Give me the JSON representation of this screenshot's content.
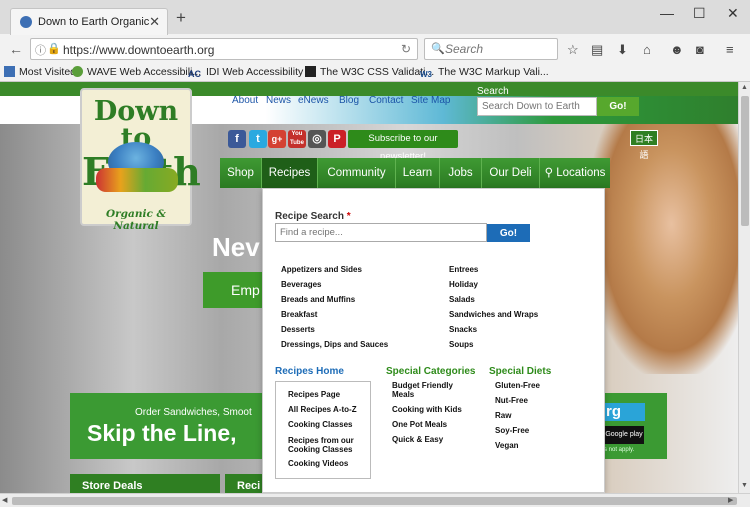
{
  "browser": {
    "tab_title": "Down to Earth Organic an...",
    "tab_close": "✕",
    "new_tab": "+",
    "window_controls": {
      "minimize": "—",
      "maximize": "☐",
      "close": "✕"
    },
    "url": "https://www.downtoearth.org",
    "search_placeholder": "Search",
    "bookmarks": [
      {
        "label": "Most Visited"
      },
      {
        "label": "WAVE Web Accessibili..."
      },
      {
        "label": "IDI Web Accessibility ..."
      },
      {
        "label": "The W3C CSS Validati..."
      },
      {
        "label": "The W3C Markup Vali..."
      }
    ],
    "icons": [
      "back-arrow-icon",
      "info-icon",
      "lock-warning-icon",
      "reload-icon",
      "search-icon",
      "star-icon",
      "reading-list-icon",
      "download-icon",
      "home-icon",
      "smiley-icon",
      "pocket-icon",
      "menu-icon"
    ]
  },
  "site": {
    "logo_line1": "Down to",
    "logo_line2": "Earth",
    "logo_tagline": "Organic & Natural",
    "top_links": [
      "About",
      "News",
      "eNews",
      "Blog",
      "Contact",
      "Site Map"
    ],
    "search_label": "Search",
    "search_placeholder": "Search Down to Earth",
    "search_button": "Go!",
    "social": [
      "f",
      "t",
      "g+",
      "You Tube",
      "◎",
      "P"
    ],
    "newsletter": "Subscribe to our newsletter!",
    "language": "日本語",
    "nav": [
      "Shop",
      "Recipes",
      "Community",
      "Learn",
      "Jobs",
      "Our Deli",
      "Locations"
    ],
    "nav_active": "Recipes",
    "hero_title": "Nev",
    "hero_button": "Emp",
    "skip_small": "Order Sandwiches, Smoot",
    "skip_big": "Skip the Line,",
    "skip_right_rg": "rg",
    "skip_right_gp": "Google play",
    "skip_right_np": "s not apply.",
    "bottom_boxes": [
      "Store Deals",
      "Reci"
    ]
  },
  "dropdown": {
    "recipe_search_label": "Recipe Search",
    "required_mark": "*",
    "recipe_search_placeholder": "Find a recipe...",
    "recipe_search_button": "Go!",
    "categories_left": [
      "Appetizers and Sides",
      "Beverages",
      "Breads and Muffins",
      "Breakfast",
      "Desserts",
      "Dressings, Dips and Sauces"
    ],
    "categories_right": [
      "Entrees",
      "Holiday",
      "Salads",
      "Sandwiches and Wraps",
      "Snacks",
      "Soups"
    ],
    "recipes_home_title": "Recipes Home",
    "recipes_home": [
      "Recipes Page",
      "All Recipes A-to-Z",
      "Cooking Classes",
      "Recipes from our Cooking Classes",
      "Cooking Videos"
    ],
    "special_categories_title": "Special Categories",
    "special_categories": [
      "Budget Friendly Meals",
      "Cooking with Kids",
      "One Pot Meals",
      "Quick & Easy"
    ],
    "special_diets_title": "Special Diets",
    "special_diets": [
      "Gluten-Free",
      "Nut-Free",
      "Raw",
      "Soy-Free",
      "Vegan"
    ]
  },
  "colors": {
    "brand_green": "#2e8b1a",
    "link_blue": "#1d6cb7",
    "button_blue": "#1d6cb7"
  }
}
